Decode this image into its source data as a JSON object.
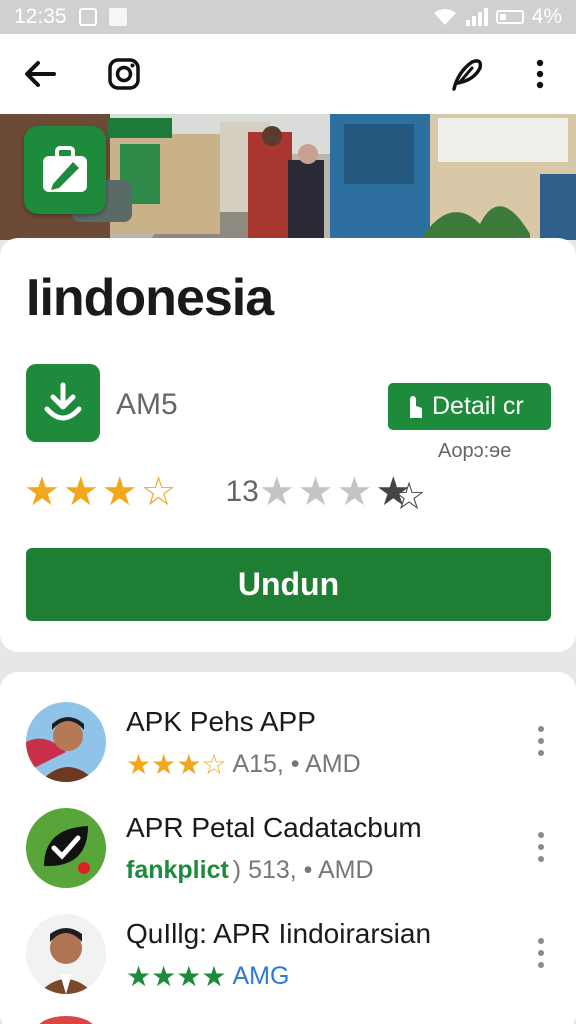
{
  "status_bar": {
    "time": "12:35",
    "battery": "4%"
  },
  "app_bar": {
    "back_icon": "arrow-left-icon",
    "instagram_icon": "instagram-icon",
    "edit_icon": "feather-pen-icon",
    "more_icon": "more-vertical-icon"
  },
  "app": {
    "title": "Iindonesia",
    "developer": "AM5",
    "detail_button": "Detail cr",
    "detail_sub": "Aopɔ:ɘe",
    "rating_value": 3.5,
    "rating_count": "13",
    "install_label": "Undun"
  },
  "related": [
    {
      "title": "APK Pehs APP",
      "rating": 3.5,
      "meta": "A15, • AMD"
    },
    {
      "title": "APR Petal Cadatacbum",
      "tag": "fankplict",
      "meta": ") 513, • AMD"
    },
    {
      "title": "QuIllg: APR Iindoirarsian",
      "rating": 4,
      "meta": "AMG"
    }
  ],
  "colors": {
    "accent": "#1e8a3c",
    "star": "#f2a81d",
    "text": "#1a1a1a"
  }
}
